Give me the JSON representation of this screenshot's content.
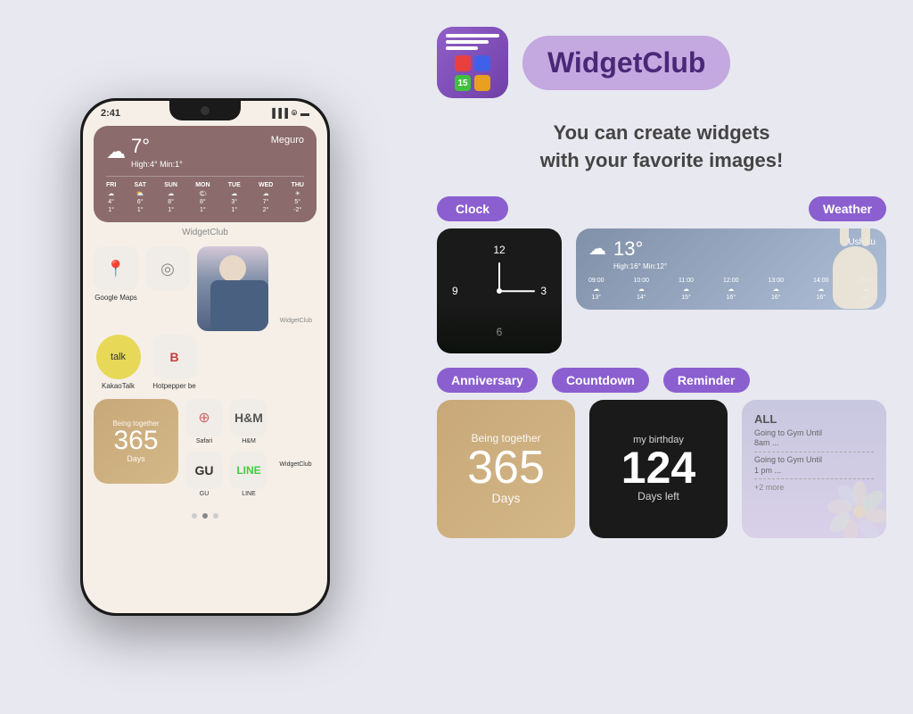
{
  "phone": {
    "time": "2:41",
    "location": "Meguro",
    "temperature": "7°",
    "high_min": "High:4° Min:1°",
    "weather_days": [
      {
        "name": "FRI",
        "icon": "☁",
        "high": "4°",
        "low": "1°"
      },
      {
        "name": "SAT",
        "icon": "⛅",
        "high": "6°",
        "low": "1°"
      },
      {
        "name": "SUN",
        "icon": "☁",
        "high": "8°",
        "low": "1°"
      },
      {
        "name": "MON",
        "icon": "🌤",
        "high": "8°",
        "low": "1°"
      },
      {
        "name": "TUE",
        "icon": "☁",
        "high": "3°",
        "low": "1°"
      },
      {
        "name": "WED",
        "icon": "☁",
        "high": "7°",
        "low": "2°"
      },
      {
        "name": "THU",
        "icon": "☀",
        "high": "5°",
        "low": "-2°"
      }
    ],
    "widget_club_label": "WidgetClub",
    "google_maps_label": "Google Maps",
    "kakao_label": "KakaoTalk",
    "hotpepper_label": "Hotpepper be",
    "widget_club_label2": "WidgetClub",
    "safari_label": "Safari",
    "hm_label": "H&M",
    "gu_label": "GU",
    "line_label": "LINE",
    "widget_club_label3": "WidgetClub",
    "being_together": "Being together",
    "days_number": "365",
    "days_label": "Days"
  },
  "app": {
    "name": "WidgetClub",
    "tagline": "You can create widgets\nwith your favorite images!"
  },
  "categories": {
    "clock_label": "Clock",
    "weather_label": "Weather",
    "anniversary_label": "Anniversary",
    "countdown_label": "Countdown",
    "reminder_label": "Reminder"
  },
  "weather_widget": {
    "temp": "13°",
    "location": "Ushiku",
    "high_min": "High:16° Min:12°",
    "hours": [
      "09:00",
      "10:00",
      "11:00",
      "12:00",
      "13:00",
      "14:00",
      "15:00"
    ],
    "temps": [
      "13°",
      "14°",
      "15°",
      "16°",
      "16°",
      "16°",
      "16°"
    ]
  },
  "countdown_widget": {
    "title": "my birthday",
    "number": "124",
    "subtitle": "Days left"
  },
  "reminder_widget": {
    "all": "ALL",
    "items": [
      "Going to Gym Until\n8am ...",
      "Going to Gym Until\n1 pm ..."
    ],
    "more": "+2 more"
  },
  "anniversary_widget": {
    "being_together": "Being together",
    "number": "365",
    "days": "Days"
  }
}
